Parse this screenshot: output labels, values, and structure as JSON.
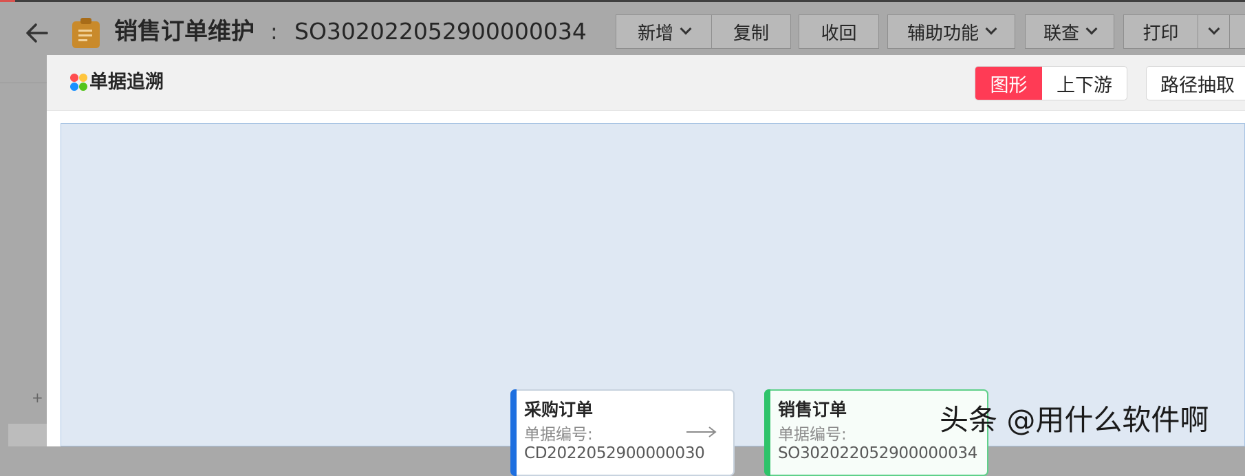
{
  "header": {
    "title": "销售订单维护",
    "separator": ":",
    "order_no": "SO302022052900000034"
  },
  "toolbar": {
    "add": "新增",
    "copy": "复制",
    "revoke": "收回",
    "aux": "辅助功能",
    "linked": "联查",
    "print": "打印"
  },
  "left": {
    "add_text": "+"
  },
  "modal": {
    "title": "单据追溯",
    "view_graph": "图形",
    "view_stream": "上下游",
    "path_extract": "路径抽取"
  },
  "nodes": [
    {
      "title": "采购订单",
      "label": "单据编号:",
      "value": "CD2022052900000030",
      "accent": "#1d6fe0"
    },
    {
      "title": "销售订单",
      "label": "单据编号:",
      "value": "SO302022052900000034",
      "accent": "#2fc36a"
    }
  ],
  "watermark": "头条 @用什么软件啊",
  "colors": {
    "active_segment": "#ff3b55",
    "canvas_bg": "#dfe8f3"
  }
}
